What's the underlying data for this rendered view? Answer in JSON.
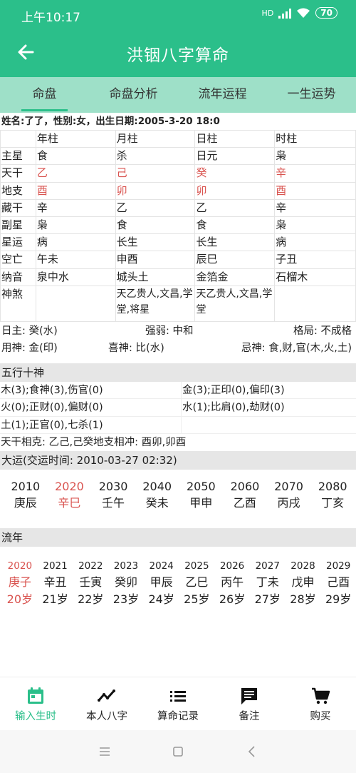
{
  "status": {
    "time": "上午10:17",
    "net": "HD",
    "battery": "70"
  },
  "app": {
    "title": "洪铟八字算命"
  },
  "tabs": [
    "命盘",
    "命盘分析",
    "流年运程",
    "一生运势"
  ],
  "info_line": "姓名:了了，性别:女，出生日期:2005-3-20 18:0",
  "pillars": {
    "headers": [
      "",
      "年柱",
      "月柱",
      "日柱",
      "时柱"
    ],
    "rows": [
      {
        "label": "主星",
        "cells": [
          "食",
          "杀",
          "日元",
          "枭"
        ]
      },
      {
        "label": "天干",
        "cells": [
          "乙",
          "己",
          "癸",
          "辛"
        ],
        "color": "#d9534f"
      },
      {
        "label": "地支",
        "cells": [
          "酉",
          "卯",
          "卯",
          "酉"
        ],
        "color": "#d9534f"
      },
      {
        "label": "藏干",
        "cells": [
          "辛",
          "乙",
          "乙",
          "辛"
        ]
      },
      {
        "label": "副星",
        "cells": [
          "枭",
          "食",
          "食",
          "枭"
        ]
      },
      {
        "label": "星运",
        "cells": [
          "病",
          "长生",
          "长生",
          "病"
        ]
      },
      {
        "label": "空亡",
        "cells": [
          "午未",
          "申酉",
          "辰巳",
          "子丑"
        ]
      },
      {
        "label": "纳音",
        "cells": [
          "泉中水",
          "城头土",
          "金箔金",
          "石榴木"
        ]
      },
      {
        "label": "神煞",
        "cells": [
          "",
          "天乙贵人,文昌,学堂,将星",
          "天乙贵人,文昌,学堂",
          ""
        ]
      }
    ]
  },
  "summary": {
    "rizhu": "日主: 癸(水)",
    "qiangruo": "强弱: 中和",
    "geju": "格局: 不成格",
    "yongshen": "用神: 金(印)",
    "xishen": "喜神: 比(水)",
    "jishen": "忌神: 食,财,官(木,火,土)"
  },
  "wuxing": {
    "title": "五行十神",
    "items": [
      "木(3);食神(3),伤官(0)",
      "金(3);正印(0),偏印(3)",
      "火(0);正财(0),偏财(0)",
      "水(1);比肩(0),劫财(0)",
      "土(1);正官(0),七杀(1)",
      ""
    ]
  },
  "xiangke": "天干相克: 乙己,己癸地支相冲: 酉卯,卯酉",
  "dayun": {
    "title": "大运(交运时间: 2010-03-27 02:32)",
    "items": [
      {
        "year": "2010",
        "gz": "庚辰"
      },
      {
        "year": "2020",
        "gz": "辛巳",
        "current": true
      },
      {
        "year": "2030",
        "gz": "壬午"
      },
      {
        "year": "2040",
        "gz": "癸未"
      },
      {
        "year": "2050",
        "gz": "甲申"
      },
      {
        "year": "2060",
        "gz": "乙酉"
      },
      {
        "year": "2070",
        "gz": "丙戌"
      },
      {
        "year": "2080",
        "gz": "丁亥"
      }
    ]
  },
  "liunian": {
    "title": "流年",
    "items": [
      {
        "year": "2020",
        "gz": "庚子",
        "age": "20岁",
        "current": true
      },
      {
        "year": "2021",
        "gz": "辛丑",
        "age": "21岁"
      },
      {
        "year": "2022",
        "gz": "壬寅",
        "age": "22岁"
      },
      {
        "year": "2023",
        "gz": "癸卯",
        "age": "23岁"
      },
      {
        "year": "2024",
        "gz": "甲辰",
        "age": "24岁"
      },
      {
        "year": "2025",
        "gz": "乙巳",
        "age": "25岁"
      },
      {
        "year": "2026",
        "gz": "丙午",
        "age": "26岁"
      },
      {
        "year": "2027",
        "gz": "丁未",
        "age": "27岁"
      },
      {
        "year": "2028",
        "gz": "戊申",
        "age": "28岁"
      },
      {
        "year": "2029",
        "gz": "己酉",
        "age": "29岁"
      }
    ]
  },
  "nav": [
    {
      "label": "输入生时",
      "icon": "calendar-icon"
    },
    {
      "label": "本人八字",
      "icon": "trend-icon"
    },
    {
      "label": "算命记录",
      "icon": "list-icon"
    },
    {
      "label": "备注",
      "icon": "chat-icon"
    },
    {
      "label": "购买",
      "icon": "cart-icon"
    }
  ],
  "colors": {
    "accent": "#2bbf8a",
    "tab_bg": "#9ee0c8",
    "highlight": "#d9534f"
  }
}
